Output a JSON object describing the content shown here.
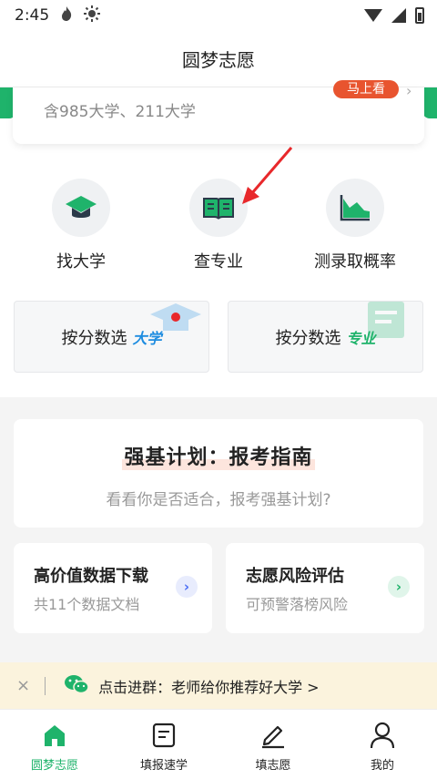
{
  "status_bar": {
    "time": "2:45"
  },
  "header": {
    "title": "圆梦志愿"
  },
  "summary_card": {
    "subtitle": "含985大学、211大学",
    "badge": "马上看",
    "chevron": "›"
  },
  "quick_actions": [
    {
      "label": "找大学",
      "icon": "graduation-cap-icon"
    },
    {
      "label": "查专业",
      "icon": "open-book-icon"
    },
    {
      "label": "测录取概率",
      "icon": "area-chart-icon"
    }
  ],
  "score_cards": [
    {
      "prefix": "按分数选",
      "accent": "大学",
      "accent_color": "#1d8ce0"
    },
    {
      "prefix": "按分数选",
      "accent": "专业",
      "accent_color": "#1fb36b"
    }
  ],
  "qiangji": {
    "title": "强基计划：报考指南",
    "desc": "看看你是否适合，报考强基计划?"
  },
  "features": [
    {
      "title": "高价值数据下载",
      "desc": "共11个数据文档",
      "arrow_color": "#4c6ef5",
      "arrow_bg": "#e8ecfd"
    },
    {
      "title": "志愿风险评估",
      "desc": "可预警落榜风险",
      "arrow_color": "#1fb36b",
      "arrow_bg": "#e0f5ea"
    }
  ],
  "banner": {
    "close": "×",
    "text": "点击进群：老师给你推荐好大学 >"
  },
  "bottom_nav": [
    {
      "label": "圆梦志愿",
      "icon": "home-icon",
      "active": true
    },
    {
      "label": "填报速学",
      "icon": "document-icon",
      "active": false
    },
    {
      "label": "填志愿",
      "icon": "pen-icon",
      "active": false
    },
    {
      "label": "我的",
      "icon": "user-icon",
      "active": false
    }
  ],
  "colors": {
    "brand_green": "#1fb36b",
    "badge_red": "#e8542f",
    "banner_bg": "#fbf3dd"
  }
}
